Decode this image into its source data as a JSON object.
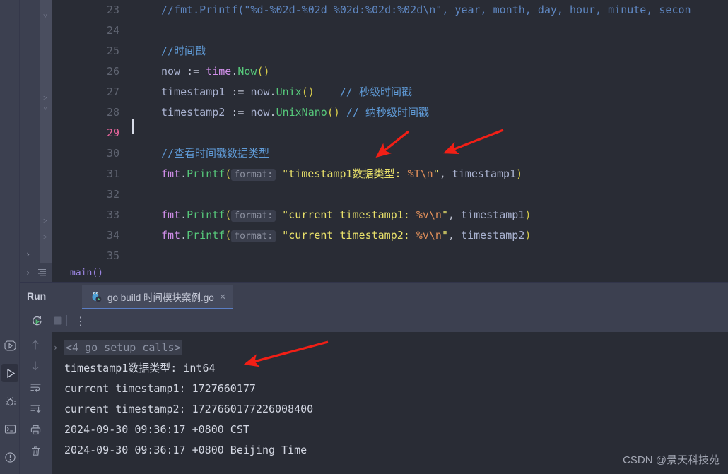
{
  "editor": {
    "lines": [
      {
        "num": "23",
        "tokens": [
          {
            "t": "cmt",
            "s": "//fmt.Printf(\"%d-%02d-%02d %02d:%02d:%02d\\n\", year, month, day, hour, minute, secon"
          }
        ]
      },
      {
        "num": "24",
        "tokens": []
      },
      {
        "num": "25",
        "tokens": [
          {
            "t": "cmt2",
            "s": "//时间戳"
          }
        ]
      },
      {
        "num": "26",
        "tokens": [
          {
            "t": "var",
            "s": "now "
          },
          {
            "t": "punct",
            "s": ":= "
          },
          {
            "t": "kw",
            "s": "time"
          },
          {
            "t": "punct",
            "s": "."
          },
          {
            "t": "fn",
            "s": "Now"
          },
          {
            "t": "paren",
            "s": "()"
          }
        ]
      },
      {
        "num": "27",
        "tokens": [
          {
            "t": "var",
            "s": "timestamp1 "
          },
          {
            "t": "punct",
            "s": ":= "
          },
          {
            "t": "var",
            "s": "now"
          },
          {
            "t": "punct",
            "s": "."
          },
          {
            "t": "fn",
            "s": "Unix"
          },
          {
            "t": "paren",
            "s": "()"
          },
          {
            "t": "punct",
            "s": "    "
          },
          {
            "t": "cmt2",
            "s": "// 秒级时间戳"
          }
        ]
      },
      {
        "num": "28",
        "tokens": [
          {
            "t": "var",
            "s": "timestamp2 "
          },
          {
            "t": "punct",
            "s": ":= "
          },
          {
            "t": "var",
            "s": "now"
          },
          {
            "t": "punct",
            "s": "."
          },
          {
            "t": "fn",
            "s": "UnixNano"
          },
          {
            "t": "paren",
            "s": "()"
          },
          {
            "t": "punct",
            "s": " "
          },
          {
            "t": "cmt2",
            "s": "// 纳秒级时间戳"
          }
        ]
      },
      {
        "num": "29",
        "tokens": [],
        "current": true
      },
      {
        "num": "30",
        "tokens": [
          {
            "t": "cmt2",
            "s": "//查看时间戳数据类型"
          }
        ]
      },
      {
        "num": "31",
        "tokens": [
          {
            "t": "kw",
            "s": "fmt"
          },
          {
            "t": "punct",
            "s": "."
          },
          {
            "t": "fn",
            "s": "Printf"
          },
          {
            "t": "paren",
            "s": "("
          },
          {
            "t": "hint",
            "s": "format:"
          },
          {
            "t": "str",
            "s": " \"timestamp1数据类型: "
          },
          {
            "t": "fmtv",
            "s": "%T\\n"
          },
          {
            "t": "str",
            "s": "\""
          },
          {
            "t": "punct",
            "s": ", "
          },
          {
            "t": "var",
            "s": "timestamp1"
          },
          {
            "t": "paren",
            "s": ")"
          }
        ]
      },
      {
        "num": "32",
        "tokens": []
      },
      {
        "num": "33",
        "tokens": [
          {
            "t": "kw",
            "s": "fmt"
          },
          {
            "t": "punct",
            "s": "."
          },
          {
            "t": "fn",
            "s": "Printf"
          },
          {
            "t": "paren",
            "s": "("
          },
          {
            "t": "hint",
            "s": "format:"
          },
          {
            "t": "str",
            "s": " \"current timestamp1: "
          },
          {
            "t": "fmtv",
            "s": "%v\\n"
          },
          {
            "t": "str",
            "s": "\""
          },
          {
            "t": "punct",
            "s": ", "
          },
          {
            "t": "var",
            "s": "timestamp1"
          },
          {
            "t": "paren",
            "s": ")"
          }
        ]
      },
      {
        "num": "34",
        "tokens": [
          {
            "t": "kw",
            "s": "fmt"
          },
          {
            "t": "punct",
            "s": "."
          },
          {
            "t": "fn",
            "s": "Printf"
          },
          {
            "t": "paren",
            "s": "("
          },
          {
            "t": "hint",
            "s": "format:"
          },
          {
            "t": "str",
            "s": " \"current timestamp2: "
          },
          {
            "t": "fmtv",
            "s": "%v\\n"
          },
          {
            "t": "str",
            "s": "\""
          },
          {
            "t": "punct",
            "s": ", "
          },
          {
            "t": "var",
            "s": "timestamp2"
          },
          {
            "t": "paren",
            "s": ")"
          }
        ]
      },
      {
        "num": "35",
        "tokens": []
      }
    ]
  },
  "breadcrumb": {
    "text": "main()"
  },
  "run_panel": {
    "title": "Run",
    "tab": {
      "label": "go build 时间模块案例.go",
      "close": "✕"
    },
    "toolbar": {
      "rerun": "rerun-icon",
      "stop": "stop-icon",
      "more": "⋮"
    }
  },
  "console": {
    "lines": [
      {
        "text": "<4 go setup calls>",
        "collapsed": true,
        "fold": "›"
      },
      {
        "text": "timestamp1数据类型: int64"
      },
      {
        "text": "current timestamp1: 1727660177"
      },
      {
        "text": "current timestamp2: 1727660177226008400"
      },
      {
        "text": "2024-09-30 09:36:17 +0800 CST"
      },
      {
        "text": "2024-09-30 09:36:17 +0800 Beijing Time"
      }
    ]
  },
  "rail": {
    "items": [
      {
        "name": "run-anything-icon",
        "selected": false
      },
      {
        "name": "run-icon",
        "selected": true
      },
      {
        "name": "debug-icon",
        "selected": false
      },
      {
        "name": "terminal-icon",
        "selected": false
      },
      {
        "name": "problems-icon",
        "selected": false
      }
    ]
  },
  "watermark": {
    "text": "CSDN @景天科技苑"
  },
  "colors": {
    "editor_bg": "#292c35",
    "panel_bg": "#3c4050",
    "gutter_bg": "#4a4e5f",
    "current_line": "#43475a",
    "accent_blue": "#5b7ec4",
    "annotation_red": "#f11f16",
    "string": "#e8e06a",
    "comment": "#5f9ad6",
    "function": "#56c77a"
  }
}
